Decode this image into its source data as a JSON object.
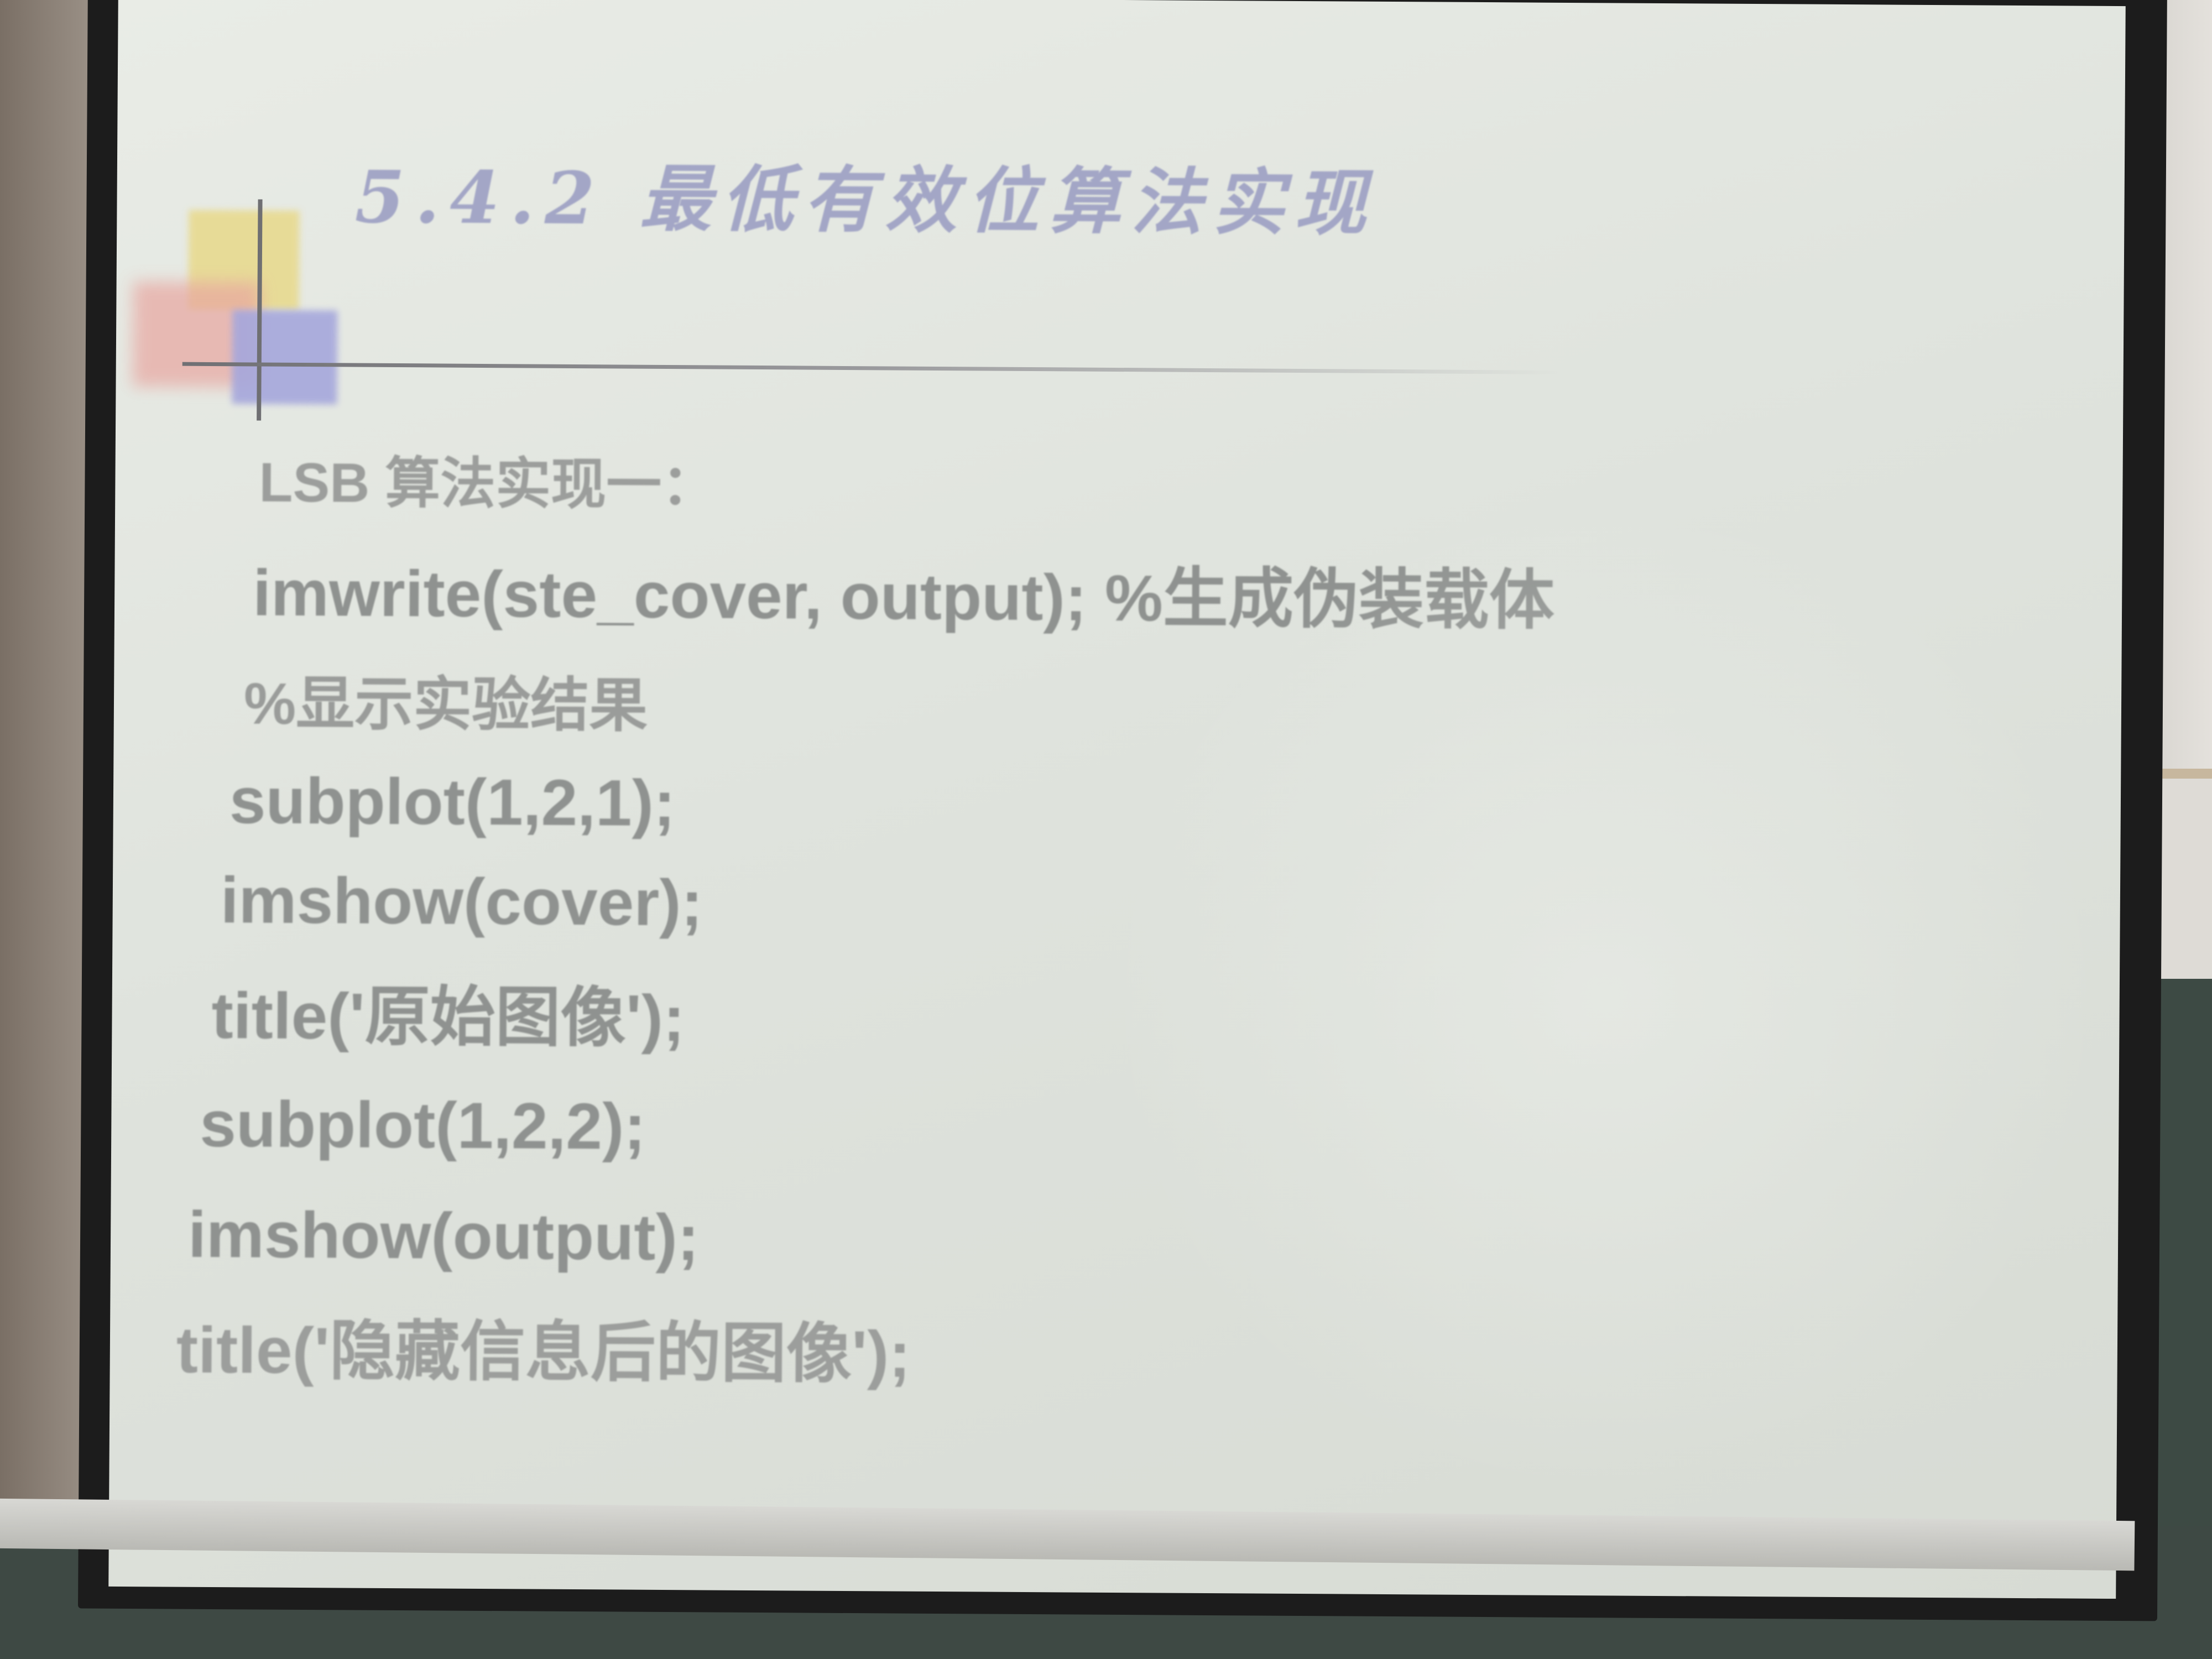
{
  "slide": {
    "title": "5.4.2 最低有效位算法实现",
    "lines": [
      "LSB 算法实现一：",
      "imwrite(ste_cover, output); %生成伪装载体",
      "%显示实验结果",
      "subplot(1,2,1);",
      "imshow(cover);",
      "title('原始图像');",
      "subplot(1,2,2);",
      "imshow(output);",
      "title('隐藏信息后的图像');"
    ]
  },
  "colors": {
    "title": "#a3a6c6",
    "text": "#8f9290",
    "screen": "#e2e6e0",
    "frame": "#1c1c1c"
  }
}
